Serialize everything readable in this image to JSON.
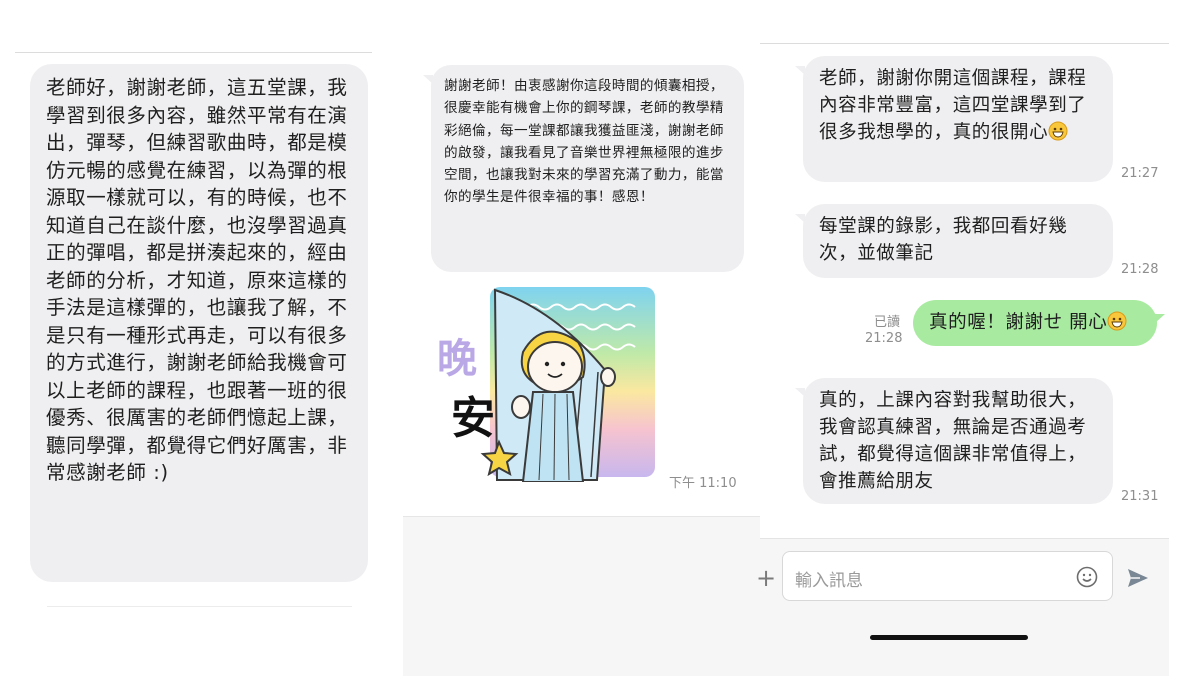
{
  "left_panel": {
    "message": "老師好，謝謝老師，這五堂課，我學習到很多內容，雖然平常有在演出，彈琴，但練習歌曲時，都是模仿元暢的感覺在練習，以為彈的根源取一樣就可以，有的時候，也不知道自己在談什麼，也沒學習過真正的彈唱，都是拼湊起來的，經由老師的分析，才知道，原來這樣的手法是這樣彈的，也讓我了解，不是只有一種形式再走，可以有很多的方式進行，謝謝老師給我機會可以上老師的課程，也跟著一班的很優秀、很厲害的老師們憶起上課，聽同學彈，都覺得它們好厲害，非常感謝老師 :)"
  },
  "middle_panel": {
    "message": "謝謝老師！由衷感謝你這段時間的傾囊相授，很慶幸能有機會上你的鋼琴課，老師的教學精彩絕倫，每一堂課都讓我獲益匪淺，謝謝老師的啟發，讓我看見了音樂世界裡無極限的進步空間，也讓我對未來的學習充滿了動力，能當你的學生是件很幸福的事！感恩！",
    "sticker": {
      "text_line1": "晚",
      "text_line2": "安",
      "icon": "goodnight-girl-sticker"
    },
    "sticker_time": "下午 11:10"
  },
  "right_panel": {
    "messages": [
      {
        "text": "老師，謝謝你開這個課程，課程內容非常豐富，這四堂課學到了很多我想學的，真的很開心",
        "emoji": "grinning-face",
        "time": "21:27"
      },
      {
        "text": "每堂課的錄影，我都回看好幾次，並做筆記",
        "time": "21:28"
      },
      {
        "text": "真的，上課內容對我幫助很大，我會認真練習，無論是否通過考試，都覺得這個課非常值得上，會推薦給朋友",
        "time": "21:31"
      }
    ],
    "my_message": {
      "text": "真的喔！謝謝せ 開心",
      "emoji": "grinning-face",
      "read_label": "已讀",
      "time": "21:28"
    },
    "input": {
      "placeholder": "輸入訊息",
      "plus_icon": "plus-icon",
      "emoji_icon": "smiley-icon",
      "send_icon": "send-icon"
    }
  },
  "colors": {
    "incoming_bubble": "#efeff1",
    "outgoing_bubble": "#a8eba0",
    "timestamp": "#8e8e8e"
  }
}
